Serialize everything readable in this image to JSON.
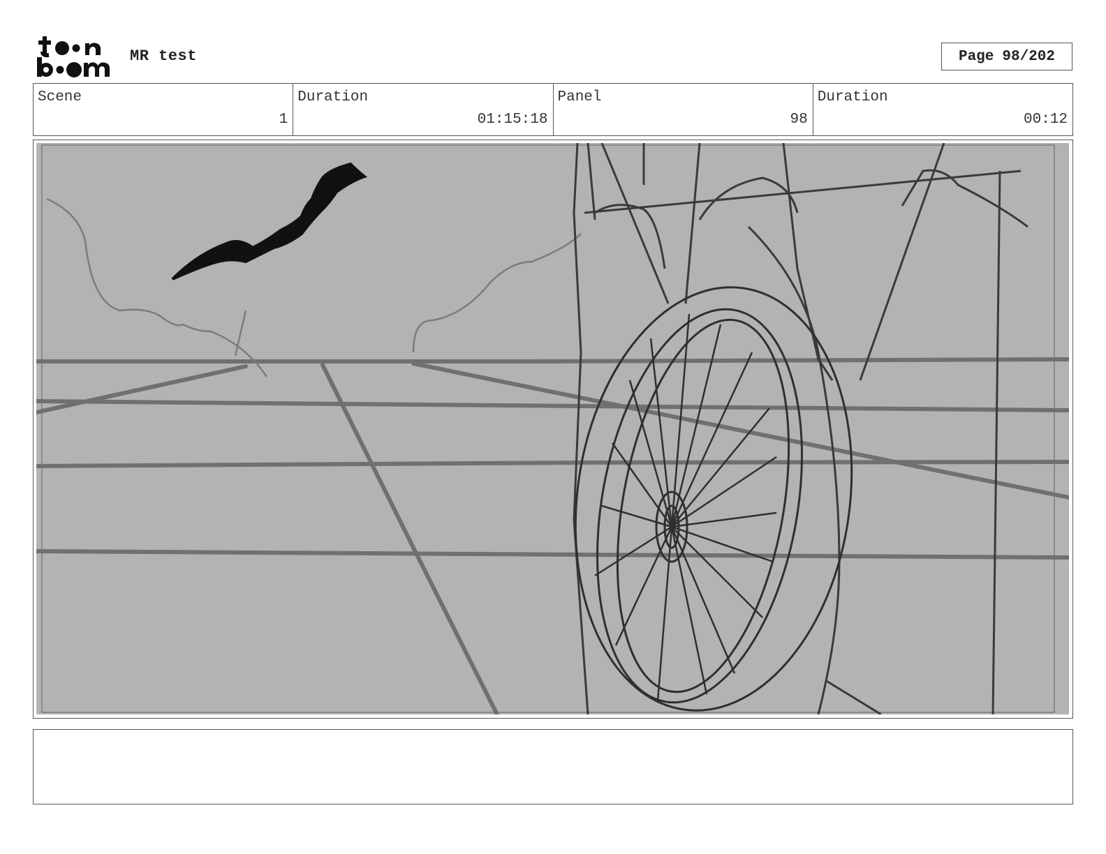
{
  "header": {
    "logo_icon": "toon-boom-logo",
    "logo_text": "toon boom",
    "project_title": "MR test",
    "page_label": "Page",
    "page_number": "98/202"
  },
  "info": {
    "scene_label": "Scene",
    "scene_value": "1",
    "scene_duration_label": "Duration",
    "scene_duration_value": "01:15:18",
    "panel_label": "Panel",
    "panel_value": "98",
    "panel_duration_label": "Duration",
    "panel_duration_value": "00:12"
  },
  "panel": {
    "image_icon": "storyboard-sketch-wagon-wheel",
    "background_color": "#b3b3b3"
  },
  "notes": {
    "text": ""
  }
}
